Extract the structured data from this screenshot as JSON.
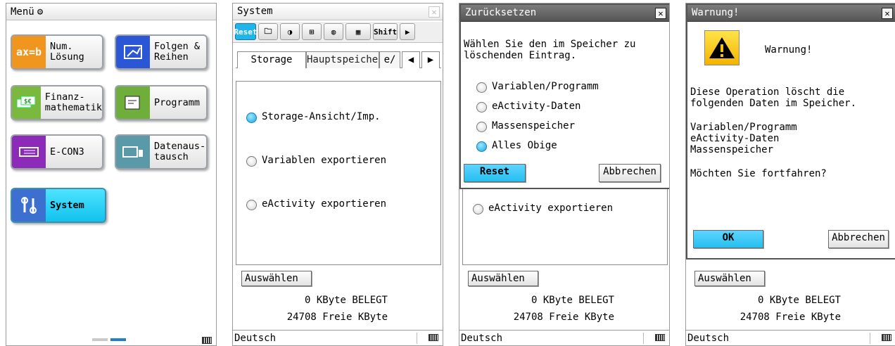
{
  "screens": {
    "menu": {
      "title": "Menü",
      "apps": [
        {
          "label": "Num. Lösung",
          "icon_text": "ax=b",
          "icon": "equation-icon",
          "color": "#f0961e"
        },
        {
          "label": "Folgen & Reihen",
          "icon_text": "",
          "icon": "sequence-graph-icon",
          "color": "#2b57d6"
        },
        {
          "label": "Finanz- mathematik",
          "icon_text": "",
          "icon": "money-icon",
          "color": "#7bb93e"
        },
        {
          "label": "Programm",
          "icon_text": "",
          "icon": "program-icon",
          "color": "#6fae3a"
        },
        {
          "label": "E-CON3",
          "icon_text": "",
          "icon": "econ-device-icon",
          "color": "#8c2bb8"
        },
        {
          "label": "Datenaus- tausch",
          "icon_text": "",
          "icon": "data-transfer-icon",
          "color": "#5a9aa8"
        },
        {
          "label": "System",
          "icon_text": "",
          "icon": "system-tools-icon",
          "color": "#3c6fcf",
          "selected": true
        }
      ]
    },
    "system": {
      "title": "System",
      "toolbar": [
        "Reset",
        "",
        "",
        "",
        "",
        "",
        "Shift",
        "▶"
      ],
      "tabs": [
        "Storage",
        "Hauptspeicher",
        "e/",
        "◀",
        "▶"
      ],
      "options": [
        "Storage-Ansicht/Imp.",
        "Variablen exportieren",
        "eActivity exportieren"
      ],
      "select_button": "Auswählen",
      "used": "0  KByte BELEGT",
      "free": "24708  Freie KByte",
      "language": "Deutsch"
    },
    "reset_dialog": {
      "title": "Zurücksetzen",
      "prompt": "Wählen Sie den im Speicher zu löschenden Eintrag.",
      "options": [
        "Variablen/Programm",
        "eActivity-Daten",
        "Massenspeicher",
        "Alles Obige"
      ],
      "ok": "Reset",
      "cancel": "Abbrechen",
      "bg_option": "eActivity exportieren"
    },
    "warning_dialog": {
      "title": "Warnung!",
      "heading": "Warnung!",
      "message": "Diese Operation löscht die folgenden Daten im Speicher.",
      "items": [
        "Variablen/Programm",
        "eActivity-Daten",
        "Massenspeicher"
      ],
      "question": "Möchten Sie fortfahren?",
      "ok": "OK",
      "cancel": "Abbrechen"
    }
  }
}
